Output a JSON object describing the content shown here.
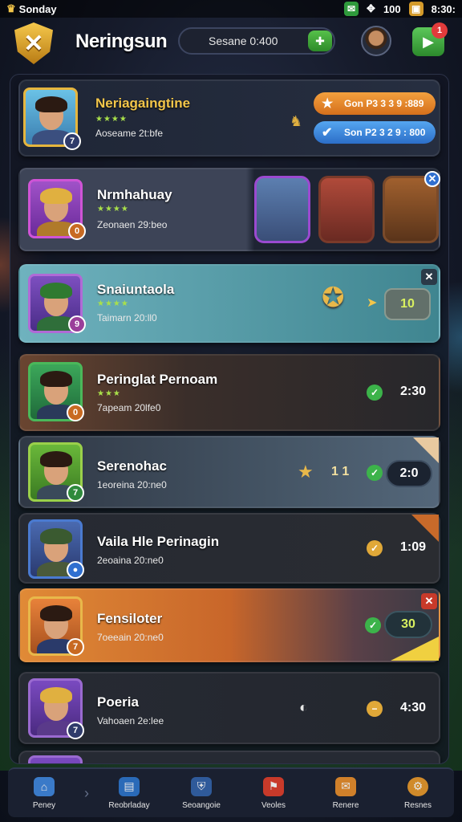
{
  "status": {
    "left_text": "Sonday",
    "right_icon_text": "100",
    "clock": "8:30:"
  },
  "header": {
    "title": "Neringsun",
    "search_value": "Sesane 0:400",
    "notification_count": "1"
  },
  "featured": {
    "name": "Neriagaingtine",
    "stars": "★★★★",
    "sub": "Aoseame 2t:bfe",
    "badge": "7",
    "button1_label": "Gon P3 3 3 9 :889",
    "button2_label": "Son P2 3 2 9 : 800"
  },
  "rows": [
    {
      "name": "Nrmhahuay",
      "stars": "★★★★",
      "sub": "Zeonaen 29:beo",
      "badge": "0"
    },
    {
      "name": "Snaiuntaola",
      "stars": "★★★★",
      "sub": "Taimarn 20:ll0",
      "badge": "9",
      "value": "10"
    },
    {
      "name": "Peringlat Pernoam",
      "stars": "★★★",
      "sub": "7apeam 20lfe0",
      "badge": "0",
      "time": "2:30"
    },
    {
      "name": "Serenohac",
      "sub": "1eoreina 20:ne0",
      "badge": "7",
      "count": "1 1",
      "value": "2:0"
    },
    {
      "name": "Vaila Hle Perinagin",
      "sub": "2eoaina 20:ne0",
      "time": "1:09"
    },
    {
      "name": "Fensiloter",
      "sub": "7oeeain 20:ne0",
      "badge": "7",
      "value": "30"
    },
    {
      "name": "Poeria",
      "sub": "Vahoaen 2e:lee",
      "badge": "7",
      "time": "4:30"
    }
  ],
  "nav": [
    {
      "label": "Peney",
      "icon": "home-icon"
    },
    {
      "label": "Reobrladay",
      "icon": "cards-icon"
    },
    {
      "label": "Seoangoie",
      "icon": "team-icon"
    },
    {
      "label": "Veoles",
      "icon": "match-icon"
    },
    {
      "label": "Renere",
      "icon": "mail-icon"
    },
    {
      "label": "Resnes",
      "icon": "settings-icon"
    }
  ],
  "colors": {
    "accent_orange": "#e98a2e",
    "accent_blue": "#3b8ae3",
    "accent_green": "#3cb34a",
    "gold": "#e6b63e"
  }
}
